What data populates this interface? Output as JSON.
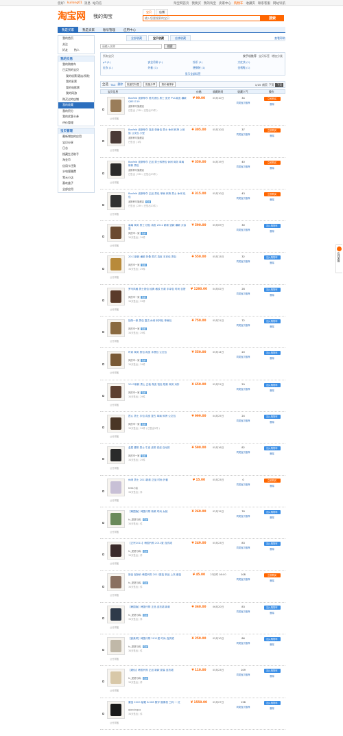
{
  "topbar": {
    "greeting": "您好!",
    "user": "kuilong01",
    "msg": "消息",
    "logout": "站内信",
    "links": [
      "淘宝网首页",
      "我要买",
      "我的淘宝",
      "卖家中心",
      "购物车",
      "收藏夹",
      "联系客服",
      "网站导航"
    ]
  },
  "logo": {
    "brand": "淘宝网",
    "sub": "我的淘宝"
  },
  "search": {
    "tabs": [
      "宝贝",
      "店铺"
    ],
    "placeholder": "输入您要搜索的宝贝",
    "button": "搜索"
  },
  "nav": [
    "我是买家",
    "我是卖家",
    "账号管理",
    "应用中心"
  ],
  "left": {
    "sec1": [
      "我的首页",
      "关注",
      "好友"
    ],
    "sec1_extra": "热人",
    "sec2_header": "我的交易",
    "sec2": [
      "我的购物车",
      "已买到的宝贝",
      "我的机票/酒店/保险",
      "我的彩票",
      "我的电影票",
      "我的网游",
      "购买过的店铺",
      "我的收藏",
      "我的积分",
      "我的优惠卡券",
      "评价管理"
    ],
    "sec3_header": "宝贝管理",
    "sec3": [
      "最新增加的应用",
      "宝贝分享",
      "日志",
      "搜藏生活助手",
      "淘金币",
      "信用卡还款",
      "水电煤缴费",
      "零元小店",
      "喜欢盒子",
      "全部应用"
    ]
  },
  "main": {
    "help": "查看帮助",
    "tabs": [
      "全部收藏",
      "宝贝收藏",
      "店铺收藏"
    ],
    "filter_placeholder": "请输入名称",
    "filter_button": "搜索",
    "cats_title": "所有宝贝",
    "cats_right": [
      "按手机推荐",
      "宝贝标签",
      "增加分类"
    ],
    "cats": [
      "p3 (1)",
      "安全吊带 (1)",
      "针织 (1)",
      "大红衣 (1)",
      "红衣 (1)",
      "外套 (1)",
      "便携装 (1)",
      "金帆鞋 (1)"
    ],
    "cats_more": "显示全部标签",
    "toolbar": {
      "all": "全选",
      "a": "TAG",
      "b": "删除",
      "btn1": "批量打标签",
      "btn2": "批量分享",
      "btn3": "按价格排序",
      "page": "1/15",
      "next": "下页",
      "prev": "前页",
      "nextpage": "下页"
    },
    "cols": [
      "宝贝信息",
      "价格",
      "收藏时间",
      "收藏人气",
      "操作"
    ]
  },
  "rows": [
    {
      "title": "Bosfeld 波斯菲尔 男式钱包 男士 皮夹 PVC真皮 横款 Q801119",
      "seller": "波斯菲尔旗舰店",
      "tag": "",
      "meta": "已售出 | 239 ( 已售出13件 )",
      "price": "¥ 99.00",
      "date": "05月10日",
      "pop": "34",
      "pop_link": "同类宝贝推荐",
      "btn": "立即购买",
      "btn_type": "orange",
      "op": "删除",
      "color": "#9a7d5a"
    },
    {
      "title": "Bosfeld 波斯菲尔 真皮 单肩包 男士 休闲 斜挎 上班族 公文包 小型",
      "seller": "波斯菲尔旗舰店",
      "tag": "",
      "meta": "已售出 | 1件",
      "price": "¥ 305.00",
      "date": "05月10日",
      "pop": "37",
      "pop_link": "同类宝贝推荐",
      "btn": "立即购买",
      "btn_type": "orange",
      "op": "删除",
      "color": "#4a3a36"
    },
    {
      "title": "Bosfeld 波斯菲尔 正品 男士斜挎包 休闲 商务 单肩 新款 男包",
      "seller": "波斯菲尔旗舰店",
      "tag": "",
      "meta": "已售出 | 239 ( 已售出13件 )",
      "price": "¥ 350.00",
      "date": "04月19日",
      "pop": "40",
      "pop_link": "同类宝贝推荐",
      "btn": "立即购买",
      "btn_type": "orange",
      "op": "删除",
      "color": "#2b2b2b"
    },
    {
      "title": "Bosfeld 波斯菲尔 正品 男包 单肩 斜挎 男士 休闲 包包",
      "seller": "波斯菲尔旗舰店",
      "tag": "包邮",
      "meta": "已售出 | 239 ( 已售出13件 )",
      "price": "¥ 315.00",
      "date": "05月10日",
      "pop": "43",
      "pop_link": "同类宝贝推荐",
      "btn": "立即购买",
      "btn_type": "orange",
      "op": "删除",
      "color": "#323232"
    },
    {
      "title": "高端 商务 男士 钱包 真皮 2012 新款 竖款 横款 大容量",
      "seller": "风的市一家",
      "tag": "包邮",
      "meta": "30天售出 | 29件",
      "price": "¥ 590.00",
      "date": "05月09日",
      "pop": "30",
      "pop_link": "同类宝贝推荐",
      "btn": "加入购物车",
      "btn_type": "blue",
      "op": "删除",
      "color": "#6b4a2f"
    },
    {
      "title": "2011新款 横款 折叠 男式 真皮 手拿包 男包",
      "seller": "风的市一家",
      "tag": "包邮",
      "meta": "30天售出 | 29件",
      "price": "¥ 550.00",
      "date": "05月13日",
      "pop": "32",
      "pop_link": "同类宝贝推荐",
      "btn": "加入购物车",
      "btn_type": "blue",
      "op": "删除",
      "color": "#b88a3a"
    },
    {
      "title": "罗马风格 男士钱包 经典 格纹 长款 手拿包 时尚 百搭",
      "seller": "风的市一家",
      "tag": "包邮",
      "meta": "30天售出 | 29件",
      "price": "¥ 1280.00",
      "date": "04月02日",
      "pop": "28",
      "pop_link": "同类宝贝推荐",
      "btn": "加入购物车",
      "btn_type": "blue",
      "op": "删除",
      "color": "#5a3b2a"
    },
    {
      "title": "独特一款 男包 复古 休闲 斜挎包 单肩包",
      "seller": "风的市一家",
      "tag": "包邮",
      "meta": "30天售出 | 29件",
      "price": "¥ 750.00",
      "date": "05月21日",
      "pop": "72",
      "pop_link": "同类宝贝推荐",
      "btn": "加入购物车",
      "btn_type": "blue",
      "op": "删除",
      "color": "#8a6a40"
    },
    {
      "title": "时尚 商务 男包 真皮 手提包 公文包",
      "seller": "风的市一家",
      "tag": "包邮",
      "meta": "30天售出 | 29件",
      "price": "¥ 550.00",
      "date": "05月14日",
      "pop": "20",
      "pop_link": "同类宝贝推荐",
      "btn": "加入购物车",
      "btn_type": "blue",
      "op": "删除",
      "color": "#7a5a36"
    },
    {
      "title": "2012新款 男士 正装 真皮 钱包 短款 商务 对折",
      "seller": "风的市一家",
      "tag": "包邮",
      "meta": "30天售出 | 29件",
      "price": "¥ 650.00",
      "date": "05月21日",
      "pop": "29",
      "pop_link": "同类宝贝推荐",
      "btn": "加入购物车",
      "btn_type": "blue",
      "op": "删除",
      "color": "#5d4030"
    },
    {
      "title": "匠心 男士 手包 真皮 复古 单肩 斜挎 公文包",
      "seller": "风的市一家",
      "tag": "包邮",
      "meta": "30天售出 | 29件 ( 已售出5件 )",
      "price": "¥ 999.00",
      "date": "04月25日",
      "pop": "24",
      "pop_link": "同类宝贝推荐",
      "btn": "加入购物车",
      "btn_type": "blue",
      "op": "删除",
      "color": "#4a3626"
    },
    {
      "title": "金属 腰带 男士 牛皮 皮带 真皮 自动扣",
      "seller": "风的市一家",
      "tag": "包邮",
      "meta": "30天售出 | 29件",
      "price": "¥ 590.00",
      "date": "05月16日",
      "pop": "82",
      "pop_link": "同类宝贝推荐",
      "btn": "加入购物车",
      "btn_type": "blue",
      "op": "删除",
      "color": "#2a2a2a"
    },
    {
      "title": "休闲 男士 2011新款 正品 时尚 外套",
      "seller": "kesk小店",
      "tag": "",
      "meta": "30天售出 | 件",
      "price": "¥ 15.00",
      "date": "05月23日",
      "pop": "0",
      "pop_link": "同类宝贝推荐",
      "btn": "立即购买",
      "btn_type": "orange",
      "op": "删除",
      "color": "#c8c0d6"
    },
    {
      "title": "【韩国版】韩国代购 新款 时尚 女装",
      "seller": "fu_夏夏与韩.",
      "tag": "包邮",
      "meta": "30天售出 | 件",
      "price": "¥ 260.00",
      "date": "02月15日",
      "pop": "76",
      "pop_link": "同类宝贝推荐",
      "btn": "加入购物车",
      "btn_type": "blue",
      "op": "删除",
      "color": "#6a8a5a"
    },
    {
      "title": "【正宗2011】韩国代购 2011夏 连衣裙",
      "seller": "fu_夏夏与韩.",
      "tag": "包邮",
      "meta": "30天售出 | 件",
      "price": "¥ 249.00",
      "date": "05月23日",
      "pop": "83",
      "pop_link": "同类宝贝推荐",
      "btn": "加入购物车",
      "btn_type": "blue",
      "op": "删除",
      "color": "#3a2a2a"
    },
    {
      "title": "新品 促销价 韩国代购 2011夏装 新品 上衣 套装",
      "seller": "fu_夏夏与韩.",
      "tag": "包邮",
      "meta": "30天售出 | 件",
      "price": "¥ 45.00",
      "date": "23日时 08:00",
      "pop": "108",
      "pop_link": "同类宝贝推荐",
      "btn": "立即购买",
      "btn_type": "orange",
      "op": "删除",
      "color": "#8a7060"
    },
    {
      "title": "【韩国版】韩国代购 正品 连衣裙 新款",
      "seller": "fu_夏夏与韩.",
      "tag": "包邮",
      "meta": "30天售出 | 件",
      "price": "¥ 360.00",
      "date": "06月20日",
      "pop": "83",
      "pop_link": "同类宝贝推荐",
      "btn": "加入购物车",
      "btn_type": "blue",
      "op": "删除",
      "color": "#2e3a4a"
    },
    {
      "title": "【欧美风】韩国代购 2011夏 时尚 连衣裙",
      "seller": "fu_夏夏与韩.",
      "tag": "包邮",
      "meta": "30天售出 | 件",
      "price": "¥ 250.00",
      "date": "05月10日",
      "pop": "86",
      "pop_link": "同类宝贝推荐",
      "btn": "加入购物车",
      "btn_type": "blue",
      "op": "删除",
      "color": "#c0b8a8"
    },
    {
      "title": "【超仙】韩国代购 正品 新款 夏装 连衣裙",
      "seller": "fu_夏夏与韩.",
      "tag": "包邮",
      "meta": "30天售出 | 件",
      "price": "¥ 110.00",
      "date": "05月23日",
      "pop": "109",
      "pop_link": "同类宝贝推荐",
      "btn": "加入购物车",
      "btn_type": "blue",
      "op": "删除",
      "color": "#d8c8a8"
    },
    {
      "title": "康宝 2020 秘籍 IN W8 数字 摄像机 三码 一 红",
      "seller": "qianxinguo",
      "tag": "",
      "meta": "30天售出 | 件",
      "price": "¥ 1550.00",
      "date": "05月07日",
      "pop": "198",
      "pop_link": "同类宝贝推荐",
      "btn": "加入购物车",
      "btn_type": "blue",
      "op": "删除",
      "color": "#1a1a1a"
    }
  ],
  "row_rec": "公分排宝",
  "float": {
    "label": "在线客服"
  }
}
